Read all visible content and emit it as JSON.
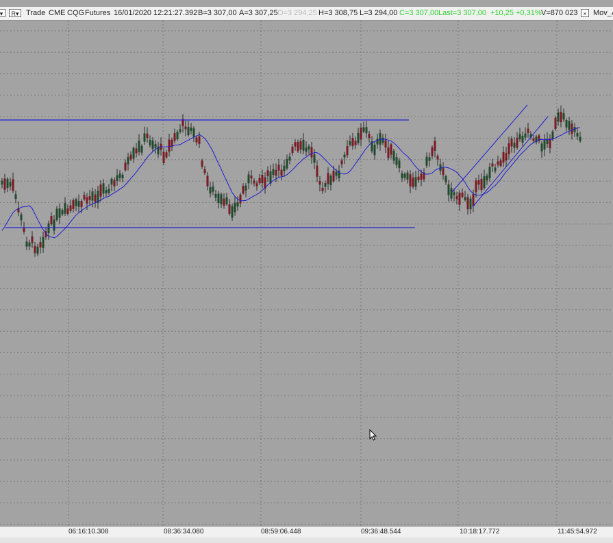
{
  "header": {
    "menu_button": "▾",
    "r_button": "R▾",
    "trade": "Trade",
    "exchange": "CME",
    "feed": "CQG",
    "type": "Futures",
    "date": "16/01/2020",
    "time": "12:21:27.392",
    "bid": "B=3 307,00",
    "ask": "A=3 307,25",
    "open": "O=3 294,25",
    "high": "H=3 308,75",
    "low": "L=3 294,00",
    "green1": "C=3 307,00",
    "green2": "Last=3 307,00",
    "green3": "+10,25",
    "green4": "+0,31%",
    "volume": "V=870 023",
    "close_icon": "×",
    "study": "Mov_A"
  },
  "colors": {
    "background": "#a3a3a3",
    "grid": "#7a7a7a",
    "bull": "#1f4a2c",
    "bear": "#7a1a22",
    "lines": "#1e1ed2"
  },
  "chart_data": {
    "type": "candlestick",
    "x_tick_labels": [
      "06:16:10.308",
      "08:36:34.080",
      "08:59:06.448",
      "09:36:48.544",
      "10:18:17.772",
      "11:45:54.972"
    ],
    "y_range": [
      3275,
      3310
    ],
    "grid": true,
    "annotations": [
      "horizontal resistance line",
      "horizontal support line",
      "upward channel",
      "moving average"
    ]
  }
}
